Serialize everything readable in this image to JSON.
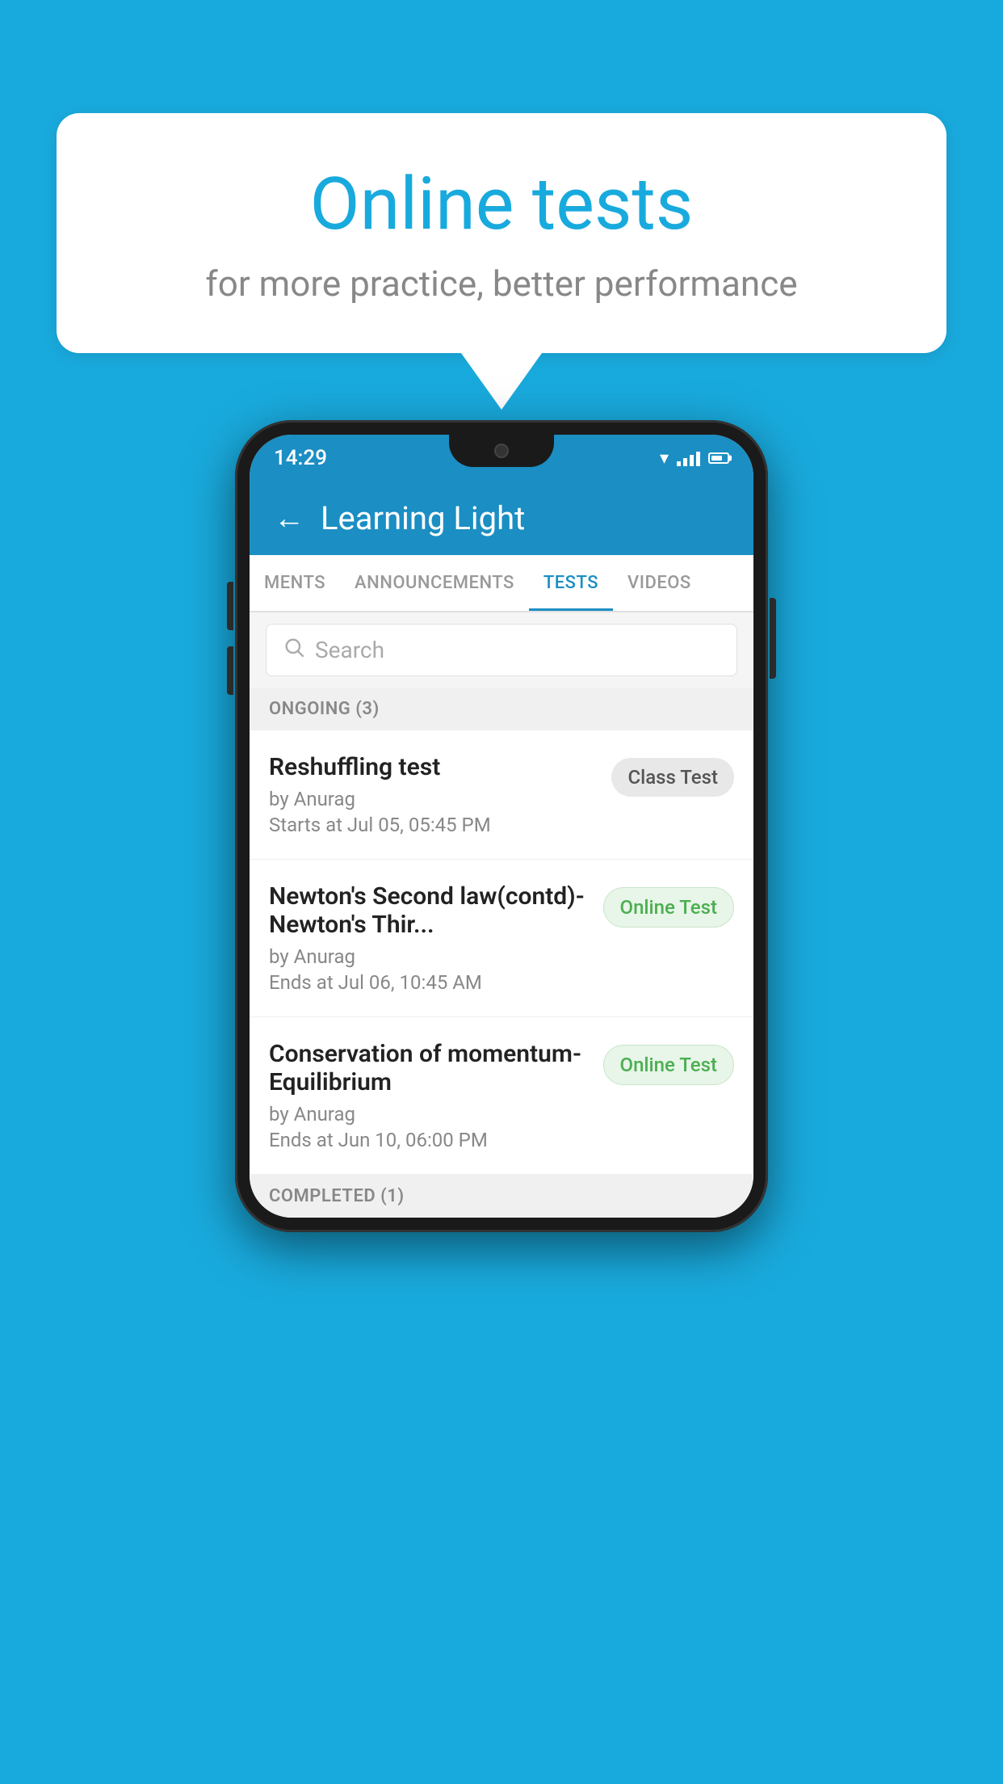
{
  "background_color": "#19AADD",
  "speech_bubble": {
    "title": "Online tests",
    "subtitle": "for more practice, better performance"
  },
  "phone": {
    "status_bar": {
      "time": "14:29"
    },
    "header": {
      "title": "Learning Light",
      "back_label": "←"
    },
    "tabs": [
      {
        "label": "MENTS",
        "active": false
      },
      {
        "label": "ANNOUNCEMENTS",
        "active": false
      },
      {
        "label": "TESTS",
        "active": true
      },
      {
        "label": "VIDEOS",
        "active": false
      }
    ],
    "search": {
      "placeholder": "Search"
    },
    "ongoing_section": {
      "label": "ONGOING (3)",
      "items": [
        {
          "name": "Reshuffling test",
          "author": "by Anurag",
          "date": "Starts at  Jul 05, 05:45 PM",
          "badge": "Class Test",
          "badge_type": "class"
        },
        {
          "name": "Newton's Second law(contd)-Newton's Thir...",
          "author": "by Anurag",
          "date": "Ends at  Jul 06, 10:45 AM",
          "badge": "Online Test",
          "badge_type": "online"
        },
        {
          "name": "Conservation of momentum-Equilibrium",
          "author": "by Anurag",
          "date": "Ends at  Jun 10, 06:00 PM",
          "badge": "Online Test",
          "badge_type": "online"
        }
      ]
    },
    "completed_section": {
      "label": "COMPLETED (1)"
    }
  }
}
